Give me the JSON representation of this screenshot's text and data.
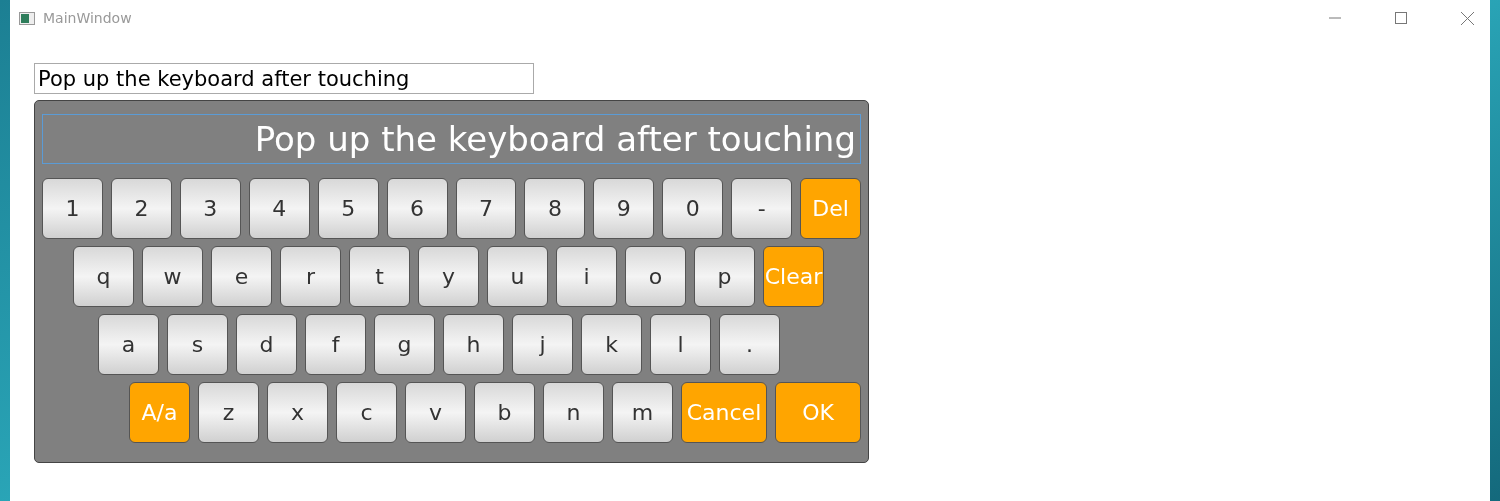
{
  "window": {
    "title": "MainWindow"
  },
  "input": {
    "value": "Pop up the keyboard after touching"
  },
  "keyboard": {
    "display": "Pop up the keyboard after touching",
    "number_row": [
      {
        "label": "1",
        "kind": "char"
      },
      {
        "label": "2",
        "kind": "char"
      },
      {
        "label": "3",
        "kind": "char"
      },
      {
        "label": "4",
        "kind": "char"
      },
      {
        "label": "5",
        "kind": "char"
      },
      {
        "label": "6",
        "kind": "char"
      },
      {
        "label": "7",
        "kind": "char"
      },
      {
        "label": "8",
        "kind": "char"
      },
      {
        "label": "9",
        "kind": "char"
      },
      {
        "label": "0",
        "kind": "char"
      },
      {
        "label": "-",
        "kind": "char"
      },
      {
        "label": "Del",
        "kind": "action"
      }
    ],
    "top_row": [
      {
        "label": "q",
        "kind": "char"
      },
      {
        "label": "w",
        "kind": "char"
      },
      {
        "label": "e",
        "kind": "char"
      },
      {
        "label": "r",
        "kind": "char"
      },
      {
        "label": "t",
        "kind": "char"
      },
      {
        "label": "y",
        "kind": "char"
      },
      {
        "label": "u",
        "kind": "char"
      },
      {
        "label": "i",
        "kind": "char"
      },
      {
        "label": "o",
        "kind": "char"
      },
      {
        "label": "p",
        "kind": "char"
      },
      {
        "label": "Clear",
        "kind": "action"
      }
    ],
    "middle_row": [
      {
        "label": "a",
        "kind": "char"
      },
      {
        "label": "s",
        "kind": "char"
      },
      {
        "label": "d",
        "kind": "char"
      },
      {
        "label": "f",
        "kind": "char"
      },
      {
        "label": "g",
        "kind": "char"
      },
      {
        "label": "h",
        "kind": "char"
      },
      {
        "label": "j",
        "kind": "char"
      },
      {
        "label": "k",
        "kind": "char"
      },
      {
        "label": "l",
        "kind": "char"
      },
      {
        "label": ".",
        "kind": "char"
      }
    ],
    "bottom_row": [
      {
        "label": "A/a",
        "kind": "action"
      },
      {
        "label": "z",
        "kind": "char"
      },
      {
        "label": "x",
        "kind": "char"
      },
      {
        "label": "c",
        "kind": "char"
      },
      {
        "label": "v",
        "kind": "char"
      },
      {
        "label": "b",
        "kind": "char"
      },
      {
        "label": "n",
        "kind": "char"
      },
      {
        "label": "m",
        "kind": "char"
      },
      {
        "label": "Cancel",
        "kind": "wide"
      },
      {
        "label": "OK",
        "kind": "wide"
      }
    ]
  }
}
